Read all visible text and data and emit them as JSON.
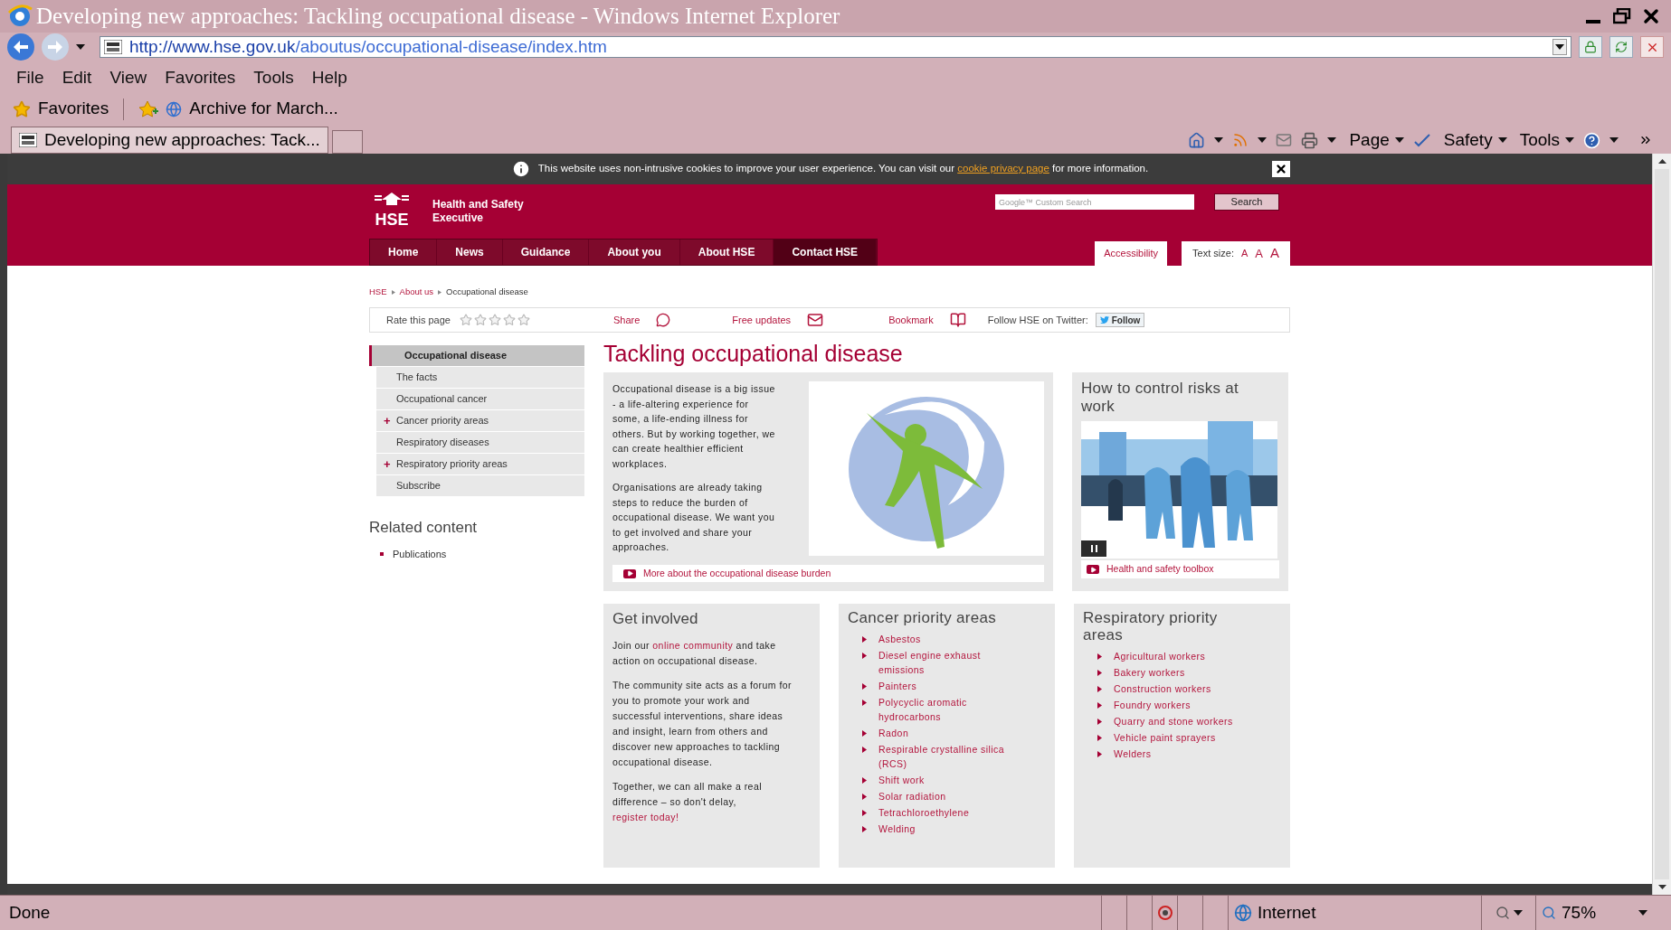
{
  "window": {
    "title": "Developing new approaches: Tackling occupational disease - Windows Internet Explorer"
  },
  "address_bar": {
    "host": "http://www.hse.gov.uk",
    "path": "/aboutus/occupational-disease/index.htm"
  },
  "menu_bar": [
    "File",
    "Edit",
    "View",
    "Favorites",
    "Tools",
    "Help"
  ],
  "favorites_bar": {
    "label": "Favorites",
    "items": [
      "Archive for March..."
    ]
  },
  "tabs": [
    {
      "label": "Developing new approaches: Tack...",
      "selected": true
    }
  ],
  "command_bar": [
    "Page",
    "Safety",
    "Tools"
  ],
  "cookie_banner": {
    "text": "This website uses non-intrusive cookies to improve your user experience. You can visit our",
    "link": "cookie privacy page",
    "after": "for more information."
  },
  "header": {
    "logo": "HSE",
    "org_name": "Health and Safety Executive",
    "search": {
      "placeholder": "Google™ Custom Search",
      "button": "Search"
    }
  },
  "nav": [
    {
      "label": "Home",
      "selected": false
    },
    {
      "label": "News",
      "selected": false
    },
    {
      "label": "Guidance",
      "selected": false
    },
    {
      "label": "About you",
      "selected": false
    },
    {
      "label": "About HSE",
      "selected": false
    },
    {
      "label": "Contact HSE",
      "selected": true
    }
  ],
  "accessibility": "Accessibility",
  "text_size": {
    "label": "Text size:",
    "sizes": [
      "A",
      "A",
      "A"
    ]
  },
  "breadcrumb": [
    "HSE",
    "About us",
    "Occupational disease"
  ],
  "page_tools": {
    "rate_label": "Rate this page",
    "stars": 0,
    "share": "Share",
    "free_updates": "Free updates",
    "bookmark": "Bookmark",
    "follow_label": "Follow HSE on Twitter:",
    "follow_button": "Follow"
  },
  "sidebar": {
    "items": [
      {
        "label": "Occupational disease",
        "selected": true
      },
      {
        "label": "The facts",
        "selected": false
      },
      {
        "label": "Occupational cancer",
        "selected": false
      },
      {
        "label": "Cancer priority areas",
        "selected": false,
        "expander": "+"
      },
      {
        "label": "Respiratory diseases",
        "selected": false
      },
      {
        "label": "Respiratory priority areas",
        "selected": false,
        "expander": "+"
      },
      {
        "label": "Subscribe",
        "selected": false
      }
    ],
    "related_title": "Related content",
    "related": [
      "Publications"
    ]
  },
  "main": {
    "title": "Tackling occupational disease",
    "paragraphs": [
      "Occupational disease is a big issue - a life-altering experience for some, a life-ending illness for others. But by working together, we can create healthier efficient workplaces.",
      "Organisations are already taking steps to reduce the burden of occupational disease. We want you to get involved and share your approaches."
    ],
    "more_link": "More about the occupational disease burden"
  },
  "risk_card": {
    "title": "How to control risks at work",
    "link": "Health and safety toolbox"
  },
  "get_involved": {
    "title": "Get involved",
    "paragraphs": [
      [
        {
          "text": "Join our ",
          "link": false
        },
        {
          "text": "online community",
          "link": true
        },
        {
          "text": " and take action on occupational disease.",
          "link": false
        }
      ],
      [
        {
          "text": "The community site acts as a forum for you to promote your work and successful interventions, share ideas and insight, learn from others and discover new approaches to tackling occupational disease.",
          "link": false
        }
      ],
      [
        {
          "text": "Together, we can all make a real difference – so don't delay, ",
          "link": false
        },
        {
          "text": "register today!",
          "link": true
        }
      ]
    ]
  },
  "cancer_areas": {
    "title": "Cancer priority areas",
    "items": [
      "Asbestos",
      "Diesel engine exhaust emissions",
      "Painters",
      "Polycyclic aromatic hydrocarbons",
      "Radon",
      "Respirable crystalline silica (RCS)",
      "Shift work",
      "Solar radiation",
      "Tetrachloroethylene",
      "Welding"
    ]
  },
  "respiratory_areas": {
    "title": "Respiratory priority areas",
    "items": [
      "Agricultural workers",
      "Bakery workers",
      "Construction workers",
      "Foundry workers",
      "Quarry and stone workers",
      "Vehicle paint sprayers",
      "Welders"
    ]
  },
  "status_bar": {
    "text": "Done",
    "zone": "Internet",
    "zoom": "75%"
  }
}
